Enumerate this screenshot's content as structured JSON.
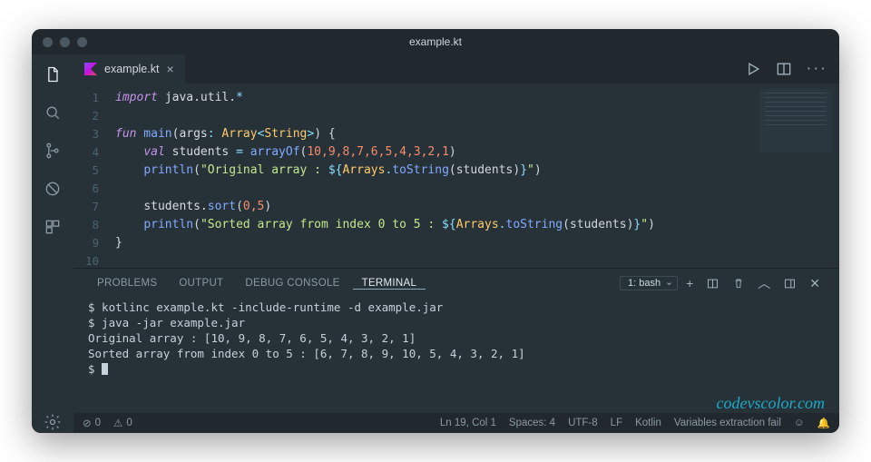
{
  "window": {
    "title": "example.kt"
  },
  "tab": {
    "filename": "example.kt"
  },
  "code": {
    "l1_kw": "import",
    "l1_pkg": " java.util.",
    "l1_star": "*",
    "l3_kw": "fun",
    "l3_fn": " main",
    "l3_p1": "(",
    "l3_arg": "args",
    "l3_c1": ": ",
    "l3_t1": "Array",
    "l3_lt": "<",
    "l3_t2": "String",
    "l3_gt": ">",
    "l3_p2": ") {",
    "l4_ind": "    ",
    "l4_kw": "val",
    "l4_id": " students ",
    "l4_eq": "=",
    "l4_fn": " arrayOf",
    "l4_p1": "(",
    "l4_nums": "10,9,8,7,6,5,4,3,2,1",
    "l4_p2": ")",
    "l5_ind": "    ",
    "l5_fn": "println",
    "l5_p1": "(",
    "l5_s1": "\"Original array : ",
    "l5_i1": "${",
    "l5_cls": "Arrays",
    "l5_dot": ".",
    "l5_m": "toString",
    "l5_pp": "(students)",
    "l5_i2": "}",
    "l5_s2": "\"",
    "l5_p2": ")",
    "l7_ind": "    ",
    "l7_obj": "students.",
    "l7_m": "sort",
    "l7_p1": "(",
    "l7_a": "0,5",
    "l7_p2": ")",
    "l8_ind": "    ",
    "l8_fn": "println",
    "l8_p1": "(",
    "l8_s1": "\"Sorted array from index 0 to 5 : ",
    "l8_i1": "${",
    "l8_cls": "Arrays",
    "l8_dot": ".",
    "l8_m": "toString",
    "l8_pp": "(students)",
    "l8_i2": "}",
    "l8_s2": "\"",
    "l8_p2": ")",
    "l9": "}"
  },
  "line_numbers": {
    "n1": "1",
    "n2": "2",
    "n3": "3",
    "n4": "4",
    "n5": "5",
    "n6": "6",
    "n7": "7",
    "n8": "8",
    "n9": "9",
    "n10": "10"
  },
  "panel": {
    "tabs": {
      "problems": "PROBLEMS",
      "output": "OUTPUT",
      "debug": "DEBUG CONSOLE",
      "terminal": "TERMINAL"
    },
    "shell_label": "1: bash"
  },
  "terminal": {
    "l1": "$ kotlinc example.kt -include-runtime -d example.jar",
    "l2": "$ java -jar example.jar",
    "l3": "Original array : [10, 9, 8, 7, 6, 5, 4, 3, 2, 1]",
    "l4": "Sorted array from index 0 to 5 : [6, 7, 8, 9, 10, 5, 4, 3, 2, 1]",
    "l5": "$ "
  },
  "status": {
    "errors": "0",
    "warnings": "0",
    "cursor": "Ln 19, Col 1",
    "spaces": "Spaces: 4",
    "encoding": "UTF-8",
    "eol": "LF",
    "lang": "Kotlin",
    "extra": "Variables extraction fail"
  },
  "watermark": "codevscolor.com"
}
